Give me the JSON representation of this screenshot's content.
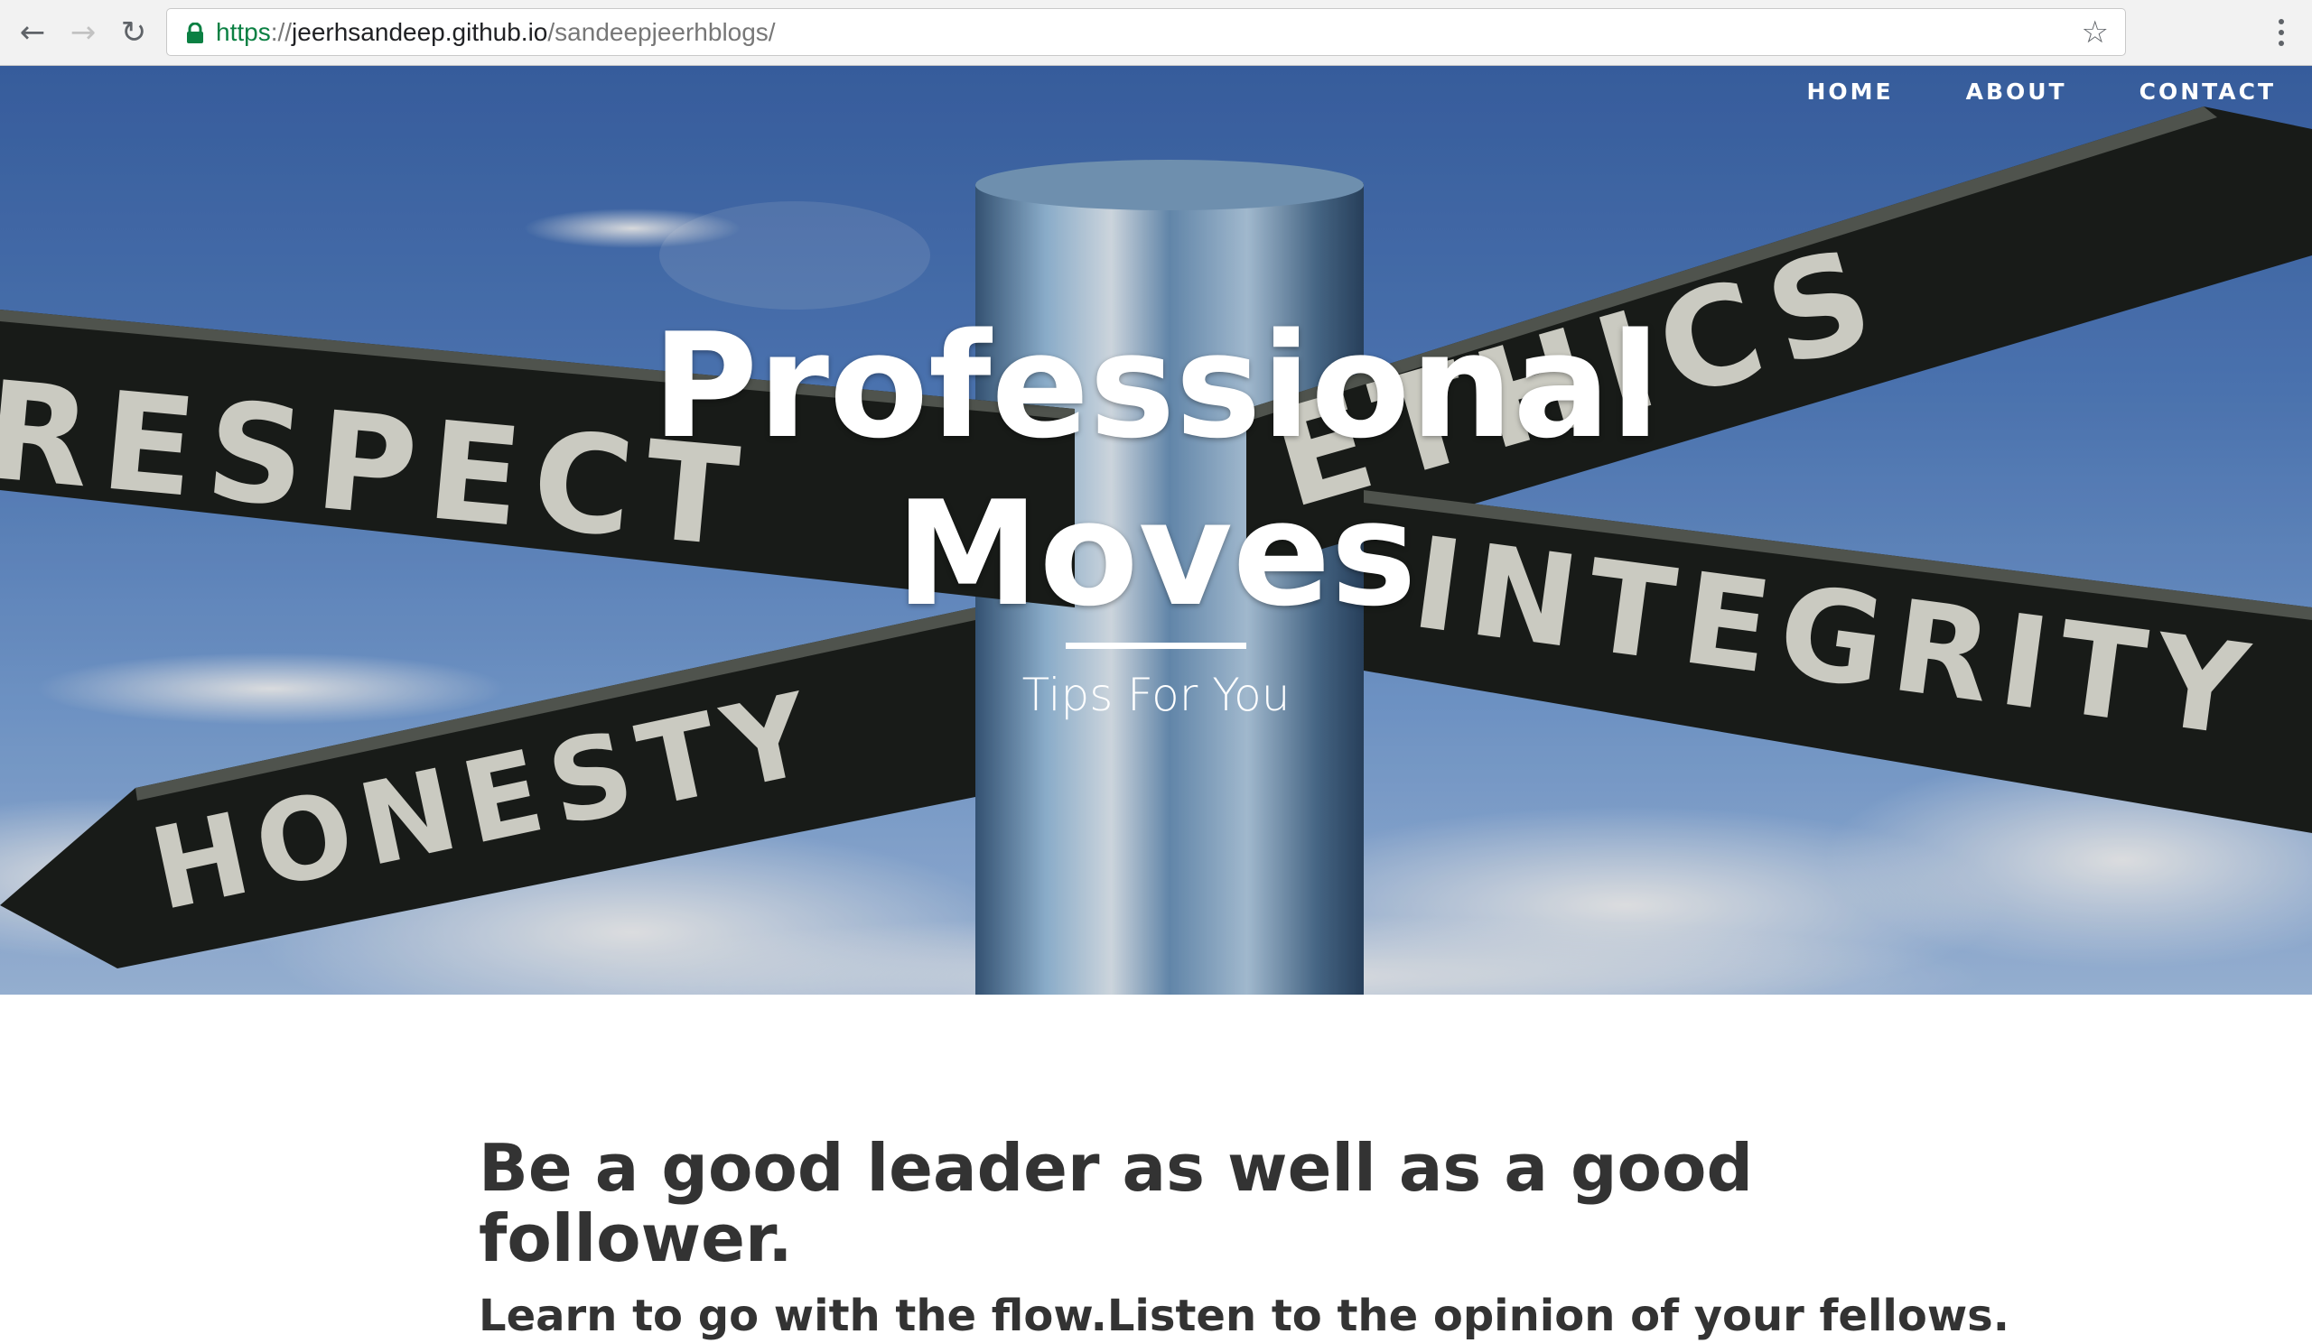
{
  "browser": {
    "url_scheme": "https",
    "url_separator": "://",
    "url_host": "jeerhsandeep.github.io",
    "url_path": "/sandeepjeerhblogs/"
  },
  "nav": {
    "items": [
      "HOME",
      "ABOUT",
      "CONTACT"
    ]
  },
  "hero": {
    "title_line1": "Professional",
    "title_line2": "Moves",
    "subtitle": "Tips For You",
    "sign_words": [
      "RESPECT",
      "ETHICS",
      "INTEGRITY",
      "HONESTY"
    ]
  },
  "post": {
    "title": "Be a good leader as well as a good follower.",
    "subtitle": "Learn to go with the flow.Listen to the opinion of your fellows."
  },
  "colors": {
    "sky_top": "#3e69b1",
    "sky_bottom": "#a9c6ec",
    "sign_board": "#1c1f1c",
    "sign_text": "#e6e6dc",
    "post_metal": "#7aa3c8",
    "heading_text": "#333333",
    "url_secure": "#0b8043"
  }
}
